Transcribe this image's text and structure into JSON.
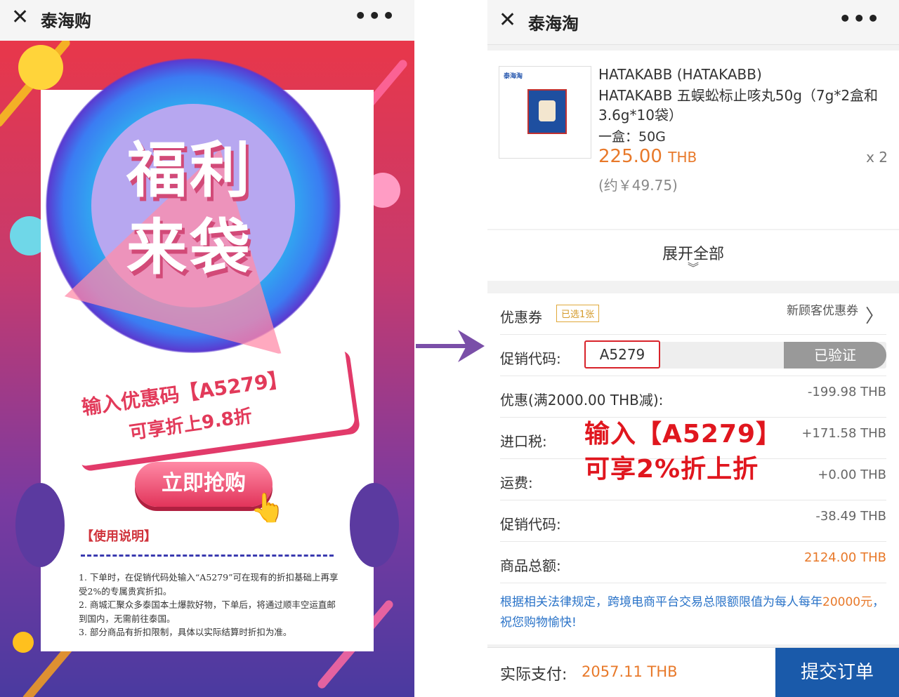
{
  "left": {
    "title": "泰海购",
    "close_glyph": "✕",
    "more_glyph": "•••",
    "poster": {
      "headline": "福利来袋",
      "banner_line1": "输入优惠码【A5279】",
      "banner_line2": "可享折上9.8折",
      "buy_button": "立即抢购",
      "usage_title": "【使用说明】",
      "usage_items": [
        "1. 下单时，在促销代码处输入“A5279”可在现有的折扣基础上再享受2%的专属贵宾折扣。",
        "2. 商城汇聚众多泰国本土爆款好物，下单后，将通过顺丰空运直邮到国内，无需前往泰国。",
        "3. 部分商品有折扣限制，具体以实际结算时折扣为准。"
      ]
    }
  },
  "right": {
    "title": "泰海淘",
    "close_glyph": "✕",
    "more_glyph": "•••",
    "product": {
      "brand": "HATAKABB (HATAKABB)",
      "name": "HATAKABB 五蜈蚣标止咳丸50g（7g*2盒和3.6g*10袋）",
      "spec": "一盒：50G",
      "price": "225.00",
      "currency": "THB",
      "qty": "x 2",
      "approx": "(约￥49.75)",
      "thumb_logo": "泰海淘"
    },
    "expand_label": "展开全部",
    "coupon": {
      "label": "优惠券",
      "badge": "已选1张",
      "sub": "新顾客优惠券"
    },
    "promo": {
      "label": "促销代码:",
      "code": "A5279",
      "status": "已验证"
    },
    "rows": [
      {
        "label": "优惠(满2000.00 THB减):",
        "value": "-199.98 THB"
      },
      {
        "label": "进口税:",
        "value": "+171.58 THB"
      },
      {
        "label": "运费:",
        "value": "+0.00 THB"
      },
      {
        "label": "促销代码:",
        "value": "-38.49 THB"
      },
      {
        "label": "商品总额:",
        "value": "2124.00 THB"
      }
    ],
    "overlay_line1": "输入【A5279】",
    "overlay_line2": "可享2%折上折",
    "notice_text": "根据相关法律规定，跨境电商平台交易总限额限值为每人每年",
    "notice_amount": "20000元",
    "notice_tail": "，祝您购物愉快!",
    "footer": {
      "label": "实际支付:",
      "value": "2057.11 THB",
      "submit": "提交订单"
    }
  },
  "colors": {
    "accent_orange": "#e8792a",
    "brand_blue": "#1a5aaa",
    "promo_red": "#e0161e"
  }
}
